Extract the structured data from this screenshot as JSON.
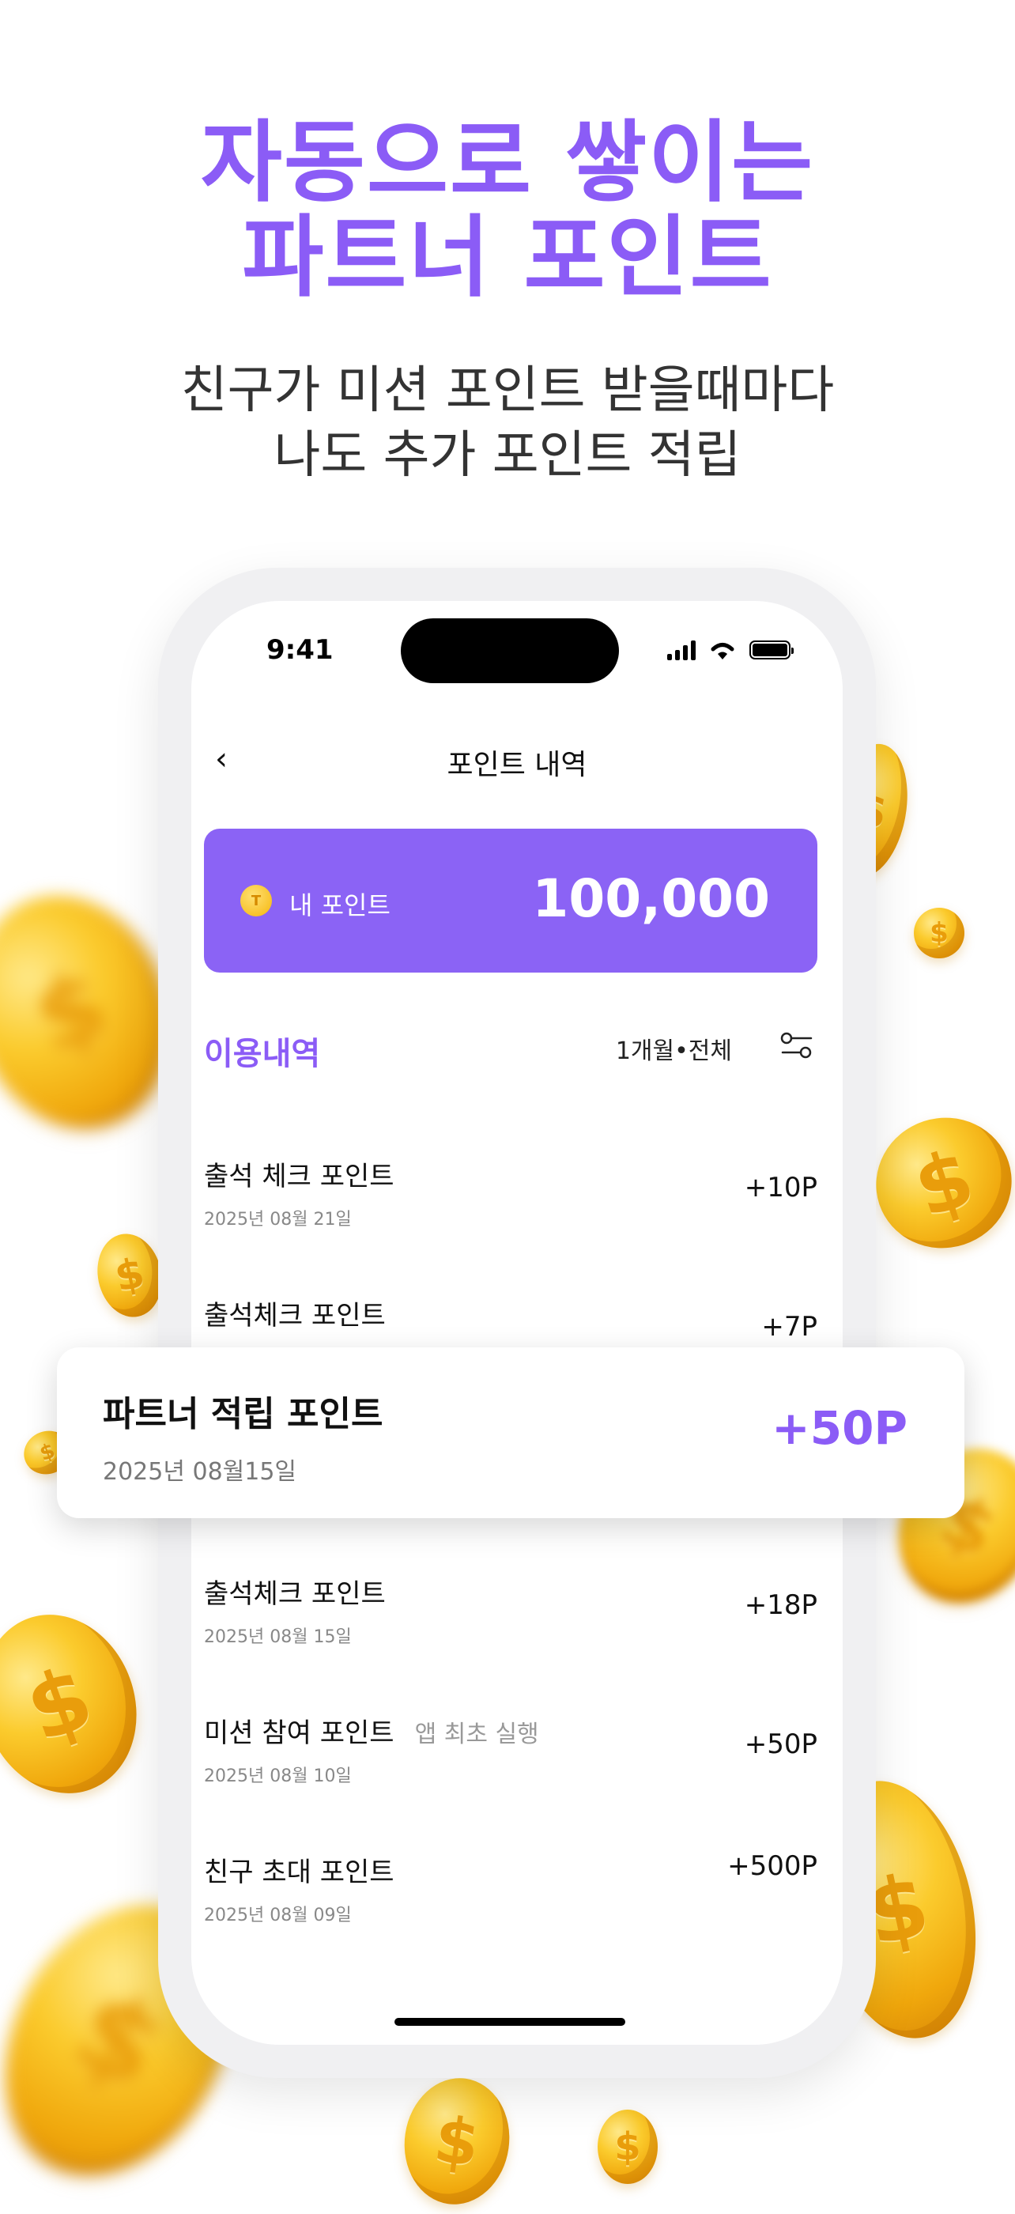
{
  "promo": {
    "headline_line1": "자동으로 쌓이는",
    "headline_line2": "파트너 포인트",
    "sub_line1": "친구가 미션 포인트 받을때마다",
    "sub_line2": "나도 추가 포인트 적립"
  },
  "status_bar": {
    "time": "9:41"
  },
  "nav": {
    "back_glyph": "‹",
    "title": "포인트 내역"
  },
  "points_card": {
    "coin_glyph": "T",
    "label": "내 포인트",
    "value": "100,000"
  },
  "history": {
    "title": "이용내역",
    "filter": "1개월•전체",
    "filter_icon": "filter-icon",
    "items": [
      {
        "title": "출석 체크 포인트",
        "tag": "",
        "date": "2025년 08월 21일",
        "value": "+10P"
      },
      {
        "title": "출석체크 포인트",
        "tag": "",
        "date": "",
        "value": "+7P"
      },
      {
        "title": "출석체크 포인트",
        "tag": "",
        "date": "2025년 08월 15일",
        "value": "+18P"
      },
      {
        "title": "미션 참여 포인트",
        "tag": "앱 최초 실행",
        "date": "2025년 08월 10일",
        "value": "+50P"
      },
      {
        "title": "친구 초대 포인트",
        "tag": "",
        "date": "2025년 08월 09일",
        "value": "+500P"
      }
    ]
  },
  "highlight_card": {
    "title": "파트너 적립 포인트",
    "date": "2025년 08월15일",
    "value": "+50P"
  },
  "colors": {
    "accent": "#8b5cf6",
    "card_bg": "#8b63f5",
    "coin": "#fbcb2d"
  },
  "decor": {
    "coin_glyph": "$"
  }
}
